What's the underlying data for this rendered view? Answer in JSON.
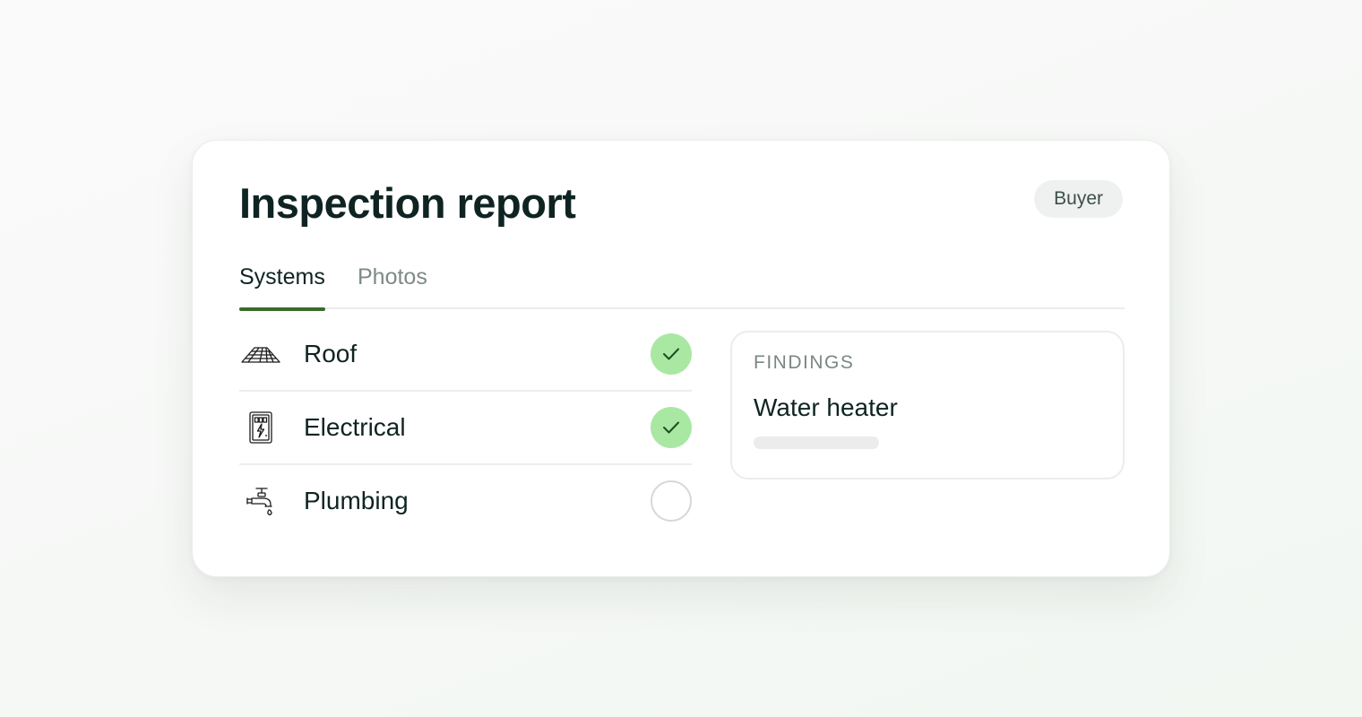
{
  "card": {
    "title": "Inspection report",
    "badge": "Buyer"
  },
  "tabs": [
    {
      "label": "Systems",
      "active": true
    },
    {
      "label": "Photos",
      "active": false
    }
  ],
  "systems": [
    {
      "label": "Roof",
      "icon": "roof-icon",
      "status": "complete"
    },
    {
      "label": "Electrical",
      "icon": "electrical-panel-icon",
      "status": "complete"
    },
    {
      "label": "Plumbing",
      "icon": "faucet-icon",
      "status": "incomplete"
    }
  ],
  "findings": {
    "heading": "FINDINGS",
    "item": "Water heater"
  },
  "colors": {
    "accent": "#3a6b2a",
    "check_fill": "#a9e8a3",
    "text": "#0f2422",
    "muted": "#7d8a88"
  }
}
